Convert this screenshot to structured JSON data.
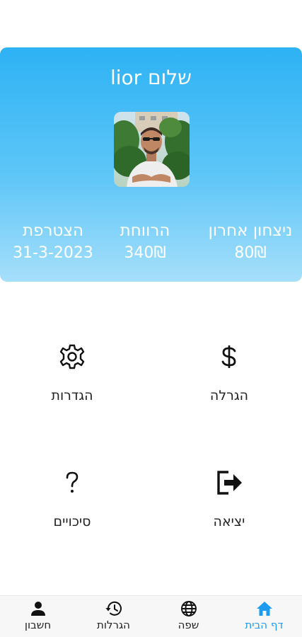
{
  "header": {
    "greeting": "שלום lior",
    "stats": {
      "last_win": {
        "label": "ניצחון אחרון",
        "value": "80₪"
      },
      "profit": {
        "label": "הרווחת",
        "value": "340₪"
      },
      "joined": {
        "label": "הצטרפת",
        "value": "31-3-2023"
      }
    }
  },
  "menu": {
    "raffle": {
      "label": "הגרלה",
      "icon": "dollar-icon"
    },
    "settings": {
      "label": "הגדרות",
      "icon": "gear-icon"
    },
    "logout": {
      "label": "יציאה",
      "icon": "logout-icon"
    },
    "chances": {
      "label": "סיכויים",
      "icon": "question-icon"
    }
  },
  "nav": {
    "items": [
      {
        "label": "דף הבית",
        "icon": "home-icon",
        "active": true
      },
      {
        "label": "שפה",
        "icon": "globe-icon",
        "active": false
      },
      {
        "label": "הגרלות",
        "icon": "history-icon",
        "active": false
      },
      {
        "label": "חשבון",
        "icon": "person-icon",
        "active": false
      }
    ]
  },
  "colors": {
    "header_gradient_top": "#2db2f4",
    "header_gradient_bottom": "#a6dffb",
    "active_nav": "#1d9bf0"
  }
}
